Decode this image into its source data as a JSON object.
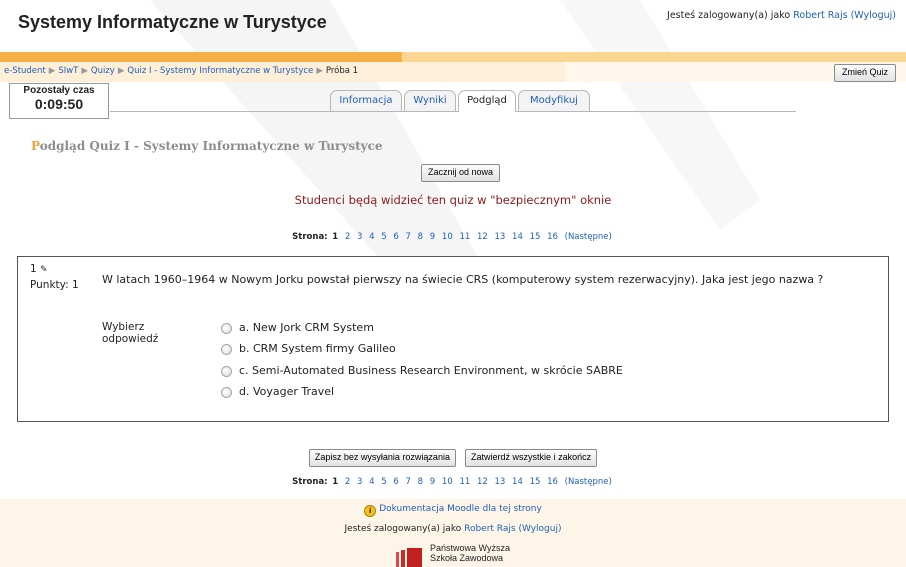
{
  "header": {
    "site_title": "Systemy Informatyczne w Turystyce",
    "login_prefix": "Jesteś zalogowany(a) jako",
    "user_name": "Robert Rajs",
    "logout_label": "(Wyloguj)"
  },
  "breadcrumb": {
    "items": [
      "e-Student",
      "SIwT",
      "Quizy",
      "Quiz I - Systemy Informatyczne w Turystyce",
      "Próba 1"
    ],
    "separator": "▶"
  },
  "change_quiz_label": "Zmień Quiz",
  "timer": {
    "label": "Pozostały czas",
    "value": "0:09:50"
  },
  "tabs": [
    {
      "label": "Informacja",
      "active": false
    },
    {
      "label": "Wyniki",
      "active": false
    },
    {
      "label": "Podgląd",
      "active": true
    },
    {
      "label": "Modyfikuj",
      "active": false
    }
  ],
  "page_heading": {
    "first_letter": "P",
    "rest": "odgląd Quiz I - Systemy Informatyczne w Turystyce"
  },
  "restart_label": "Zacznij od nowa",
  "secure_note": "Studenci będą widzieć ten quiz w \"bezpiecznym\" oknie",
  "pagination": {
    "label": "Strona:",
    "current": "1",
    "pages": [
      "2",
      "3",
      "4",
      "5",
      "6",
      "7",
      "8",
      "9",
      "10",
      "11",
      "12",
      "13",
      "14",
      "15",
      "16"
    ],
    "next_label": "(Następne)"
  },
  "question": {
    "number": "1",
    "points_label": "Punkty: 1",
    "text": "W latach 1960–1964 w Nowym Jorku powstał pierwszy na świecie CRS (komputerowy system rezerwacyjny). Jaka jest jego nazwa ?",
    "prompt": "Wybierz odpowiedź",
    "answers": [
      "a. New Jork CRM System",
      "b. CRM System firmy Galileo",
      "c. Semi-Automated Business Research Environment, w skrócie SABRE",
      "d. Voyager Travel"
    ]
  },
  "buttons": {
    "save_label": "Zapisz bez wysyłania rozwiązania",
    "submit_label": "Zatwierdź wszystkie i zakończ"
  },
  "footer": {
    "doc_link": "Dokumentacja Moodle dla tej strony",
    "login_prefix": "Jesteś zalogowany(a) jako",
    "user_name": "Robert Rajs",
    "logout_label": "(Wyloguj)",
    "school_name_line1": "Państwowa Wyższa",
    "school_name_line2": "Szkoła Zawodowa"
  },
  "colors": {
    "link": "#1f5fb8",
    "navbar_dark": "#f5b04a",
    "navbar_light": "#fdefd8",
    "secure_note": "#8b1a1a",
    "footer_bg": "#fdf6e8"
  }
}
